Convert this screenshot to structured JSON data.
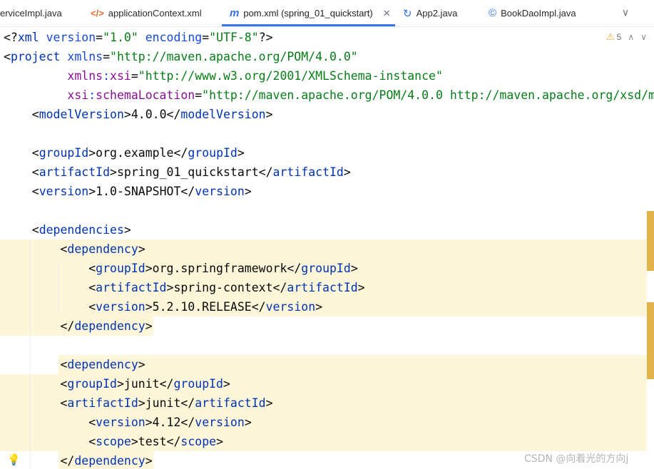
{
  "tabs": [
    {
      "label": "erviceImpl.java",
      "icon": ""
    },
    {
      "label": "applicationContext.xml",
      "icon": "xml-file-icon"
    },
    {
      "label": "pom.xml (spring_01_quickstart)",
      "icon": "maven-m-icon",
      "active": true
    },
    {
      "label": "App2.java",
      "icon": "java-app-icon"
    },
    {
      "label": "BookDaoImpl.java",
      "icon": "java-class-icon"
    }
  ],
  "icons": {
    "xml": "</>",
    "maven": "m",
    "app": "↻",
    "class": "©",
    "close": "✕",
    "chevron": "∨",
    "warn": "⚠",
    "up": "∧",
    "down": "∨",
    "bulb": "💡"
  },
  "editor": {
    "warning_count": "5",
    "code_lines": [
      "<?xml version=\"1.0\" encoding=\"UTF-8\"?>",
      "<project xmlns=\"http://maven.apache.org/POM/4.0.0\"",
      "         xmlns:xsi=\"http://www.w3.org/2001/XMLSchema-instance\"",
      "         xsi:schemaLocation=\"http://maven.apache.org/POM/4.0.0 http://maven.apache.org/xsd/m",
      "    <modelVersion>4.0.0</modelVersion>",
      "",
      "    <groupId>org.example</groupId>",
      "    <artifactId>spring_01_quickstart</artifactId>",
      "    <version>1.0-SNAPSHOT</version>",
      "",
      "    <dependencies>",
      "        <dependency>",
      "            <groupId>org.springframework</groupId>",
      "            <artifactId>spring-context</artifactId>",
      "            <version>5.2.10.RELEASE</version>",
      "        </dependency>",
      "",
      "        <dependency>",
      "        <groupId>junit</groupId>",
      "        <artifactId>junit</artifactId>",
      "            <version>4.12</version>",
      "            <scope>test</scope>",
      "        </dependency>"
    ]
  },
  "watermark": "CSDN @向着光的方向j"
}
